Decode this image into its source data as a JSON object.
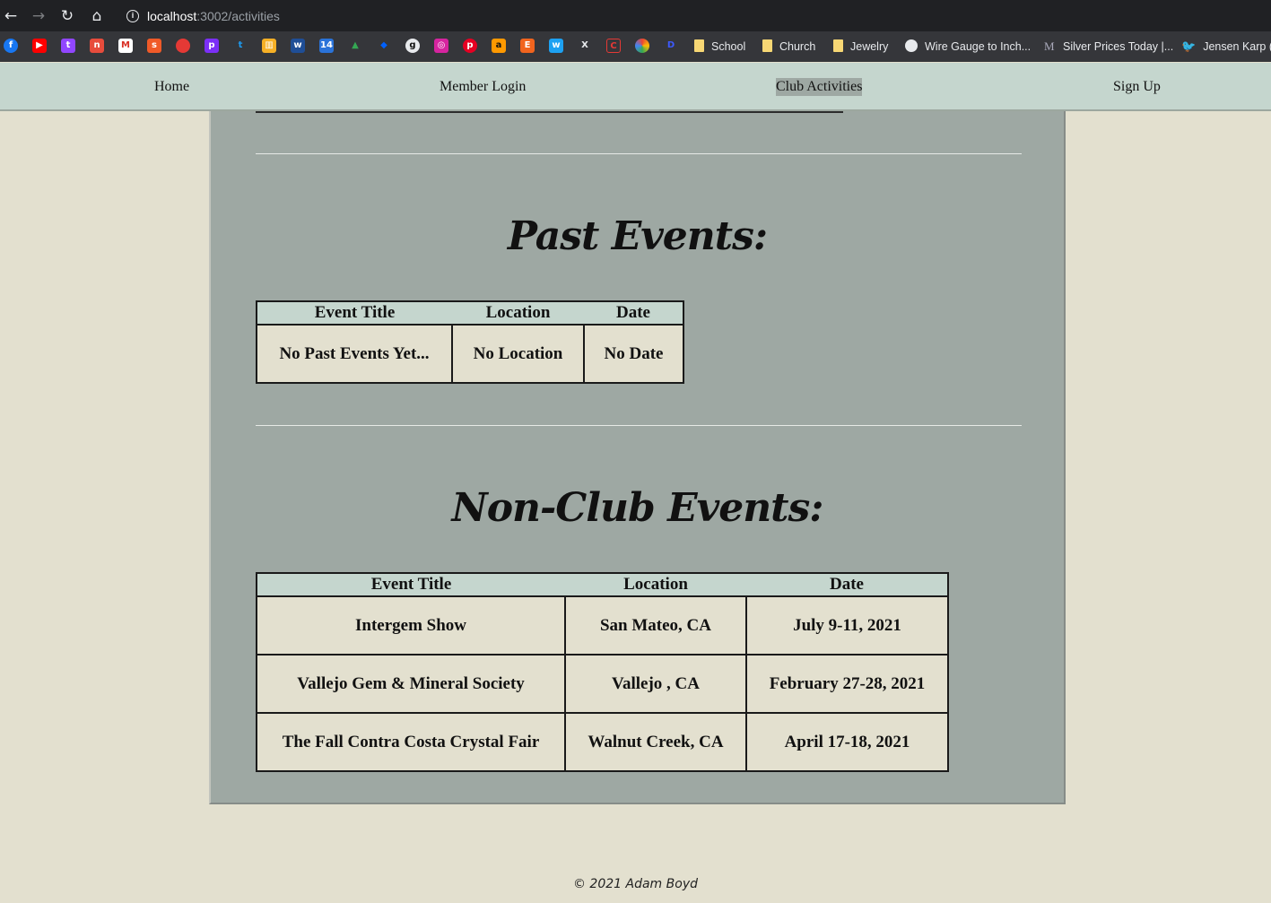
{
  "browser": {
    "url_host": "localhost",
    "url_rest": ":3002/activities",
    "bookmarks": [
      "School",
      "Church",
      "Jewelry",
      "Wire Gauge to Inch...",
      "Silver Prices Today |...",
      "Jensen Karp (@"
    ]
  },
  "nav": {
    "home": "Home",
    "member_login": "Member Login",
    "club_activities": "Club Activities",
    "sign_up": "Sign Up"
  },
  "past_events": {
    "title": "Past Events:",
    "headers": [
      "Event Title",
      "Location",
      "Date"
    ],
    "rows": [
      [
        "No Past Events Yet...",
        "No Location",
        "No Date"
      ]
    ]
  },
  "non_club_events": {
    "title": "Non-Club Events:",
    "headers": [
      "Event Title",
      "Location",
      "Date"
    ],
    "rows": [
      [
        "Intergem Show",
        "San Mateo, CA",
        "July 9-11, 2021"
      ],
      [
        "Vallejo Gem & Mineral Society",
        "Vallejo , CA",
        "February 27-28, 2021"
      ],
      [
        "The Fall Contra Costa Crystal Fair",
        "Walnut Creek, CA",
        "April 17-18, 2021"
      ]
    ]
  },
  "footer": "© 2021 Adam Boyd"
}
